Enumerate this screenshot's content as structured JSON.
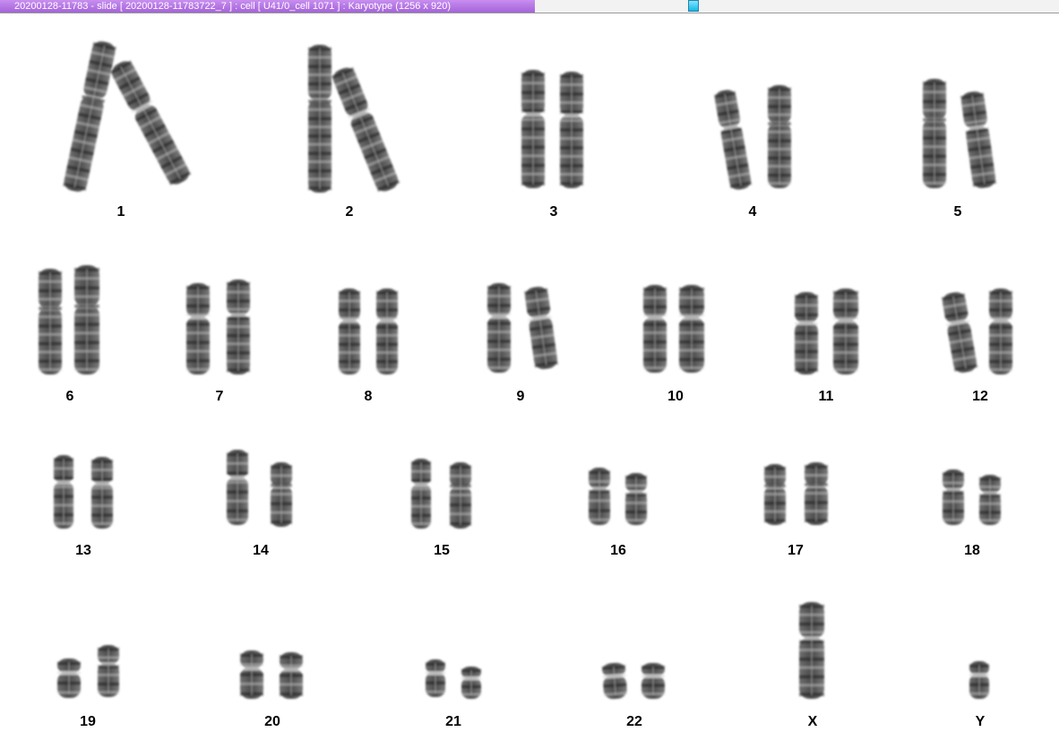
{
  "window": {
    "title": "20200128-11783 - slide [  20200128-11783722_7 ] : cell [ U41/0_cell 1071 ] : Karyotype  (1256 x 920)"
  },
  "karyotype": {
    "labels": [
      "1",
      "2",
      "3",
      "4",
      "5",
      "6",
      "7",
      "8",
      "9",
      "10",
      "11",
      "12",
      "13",
      "14",
      "15",
      "16",
      "17",
      "18",
      "19",
      "20",
      "21",
      "22",
      "X",
      "Y"
    ]
  }
}
